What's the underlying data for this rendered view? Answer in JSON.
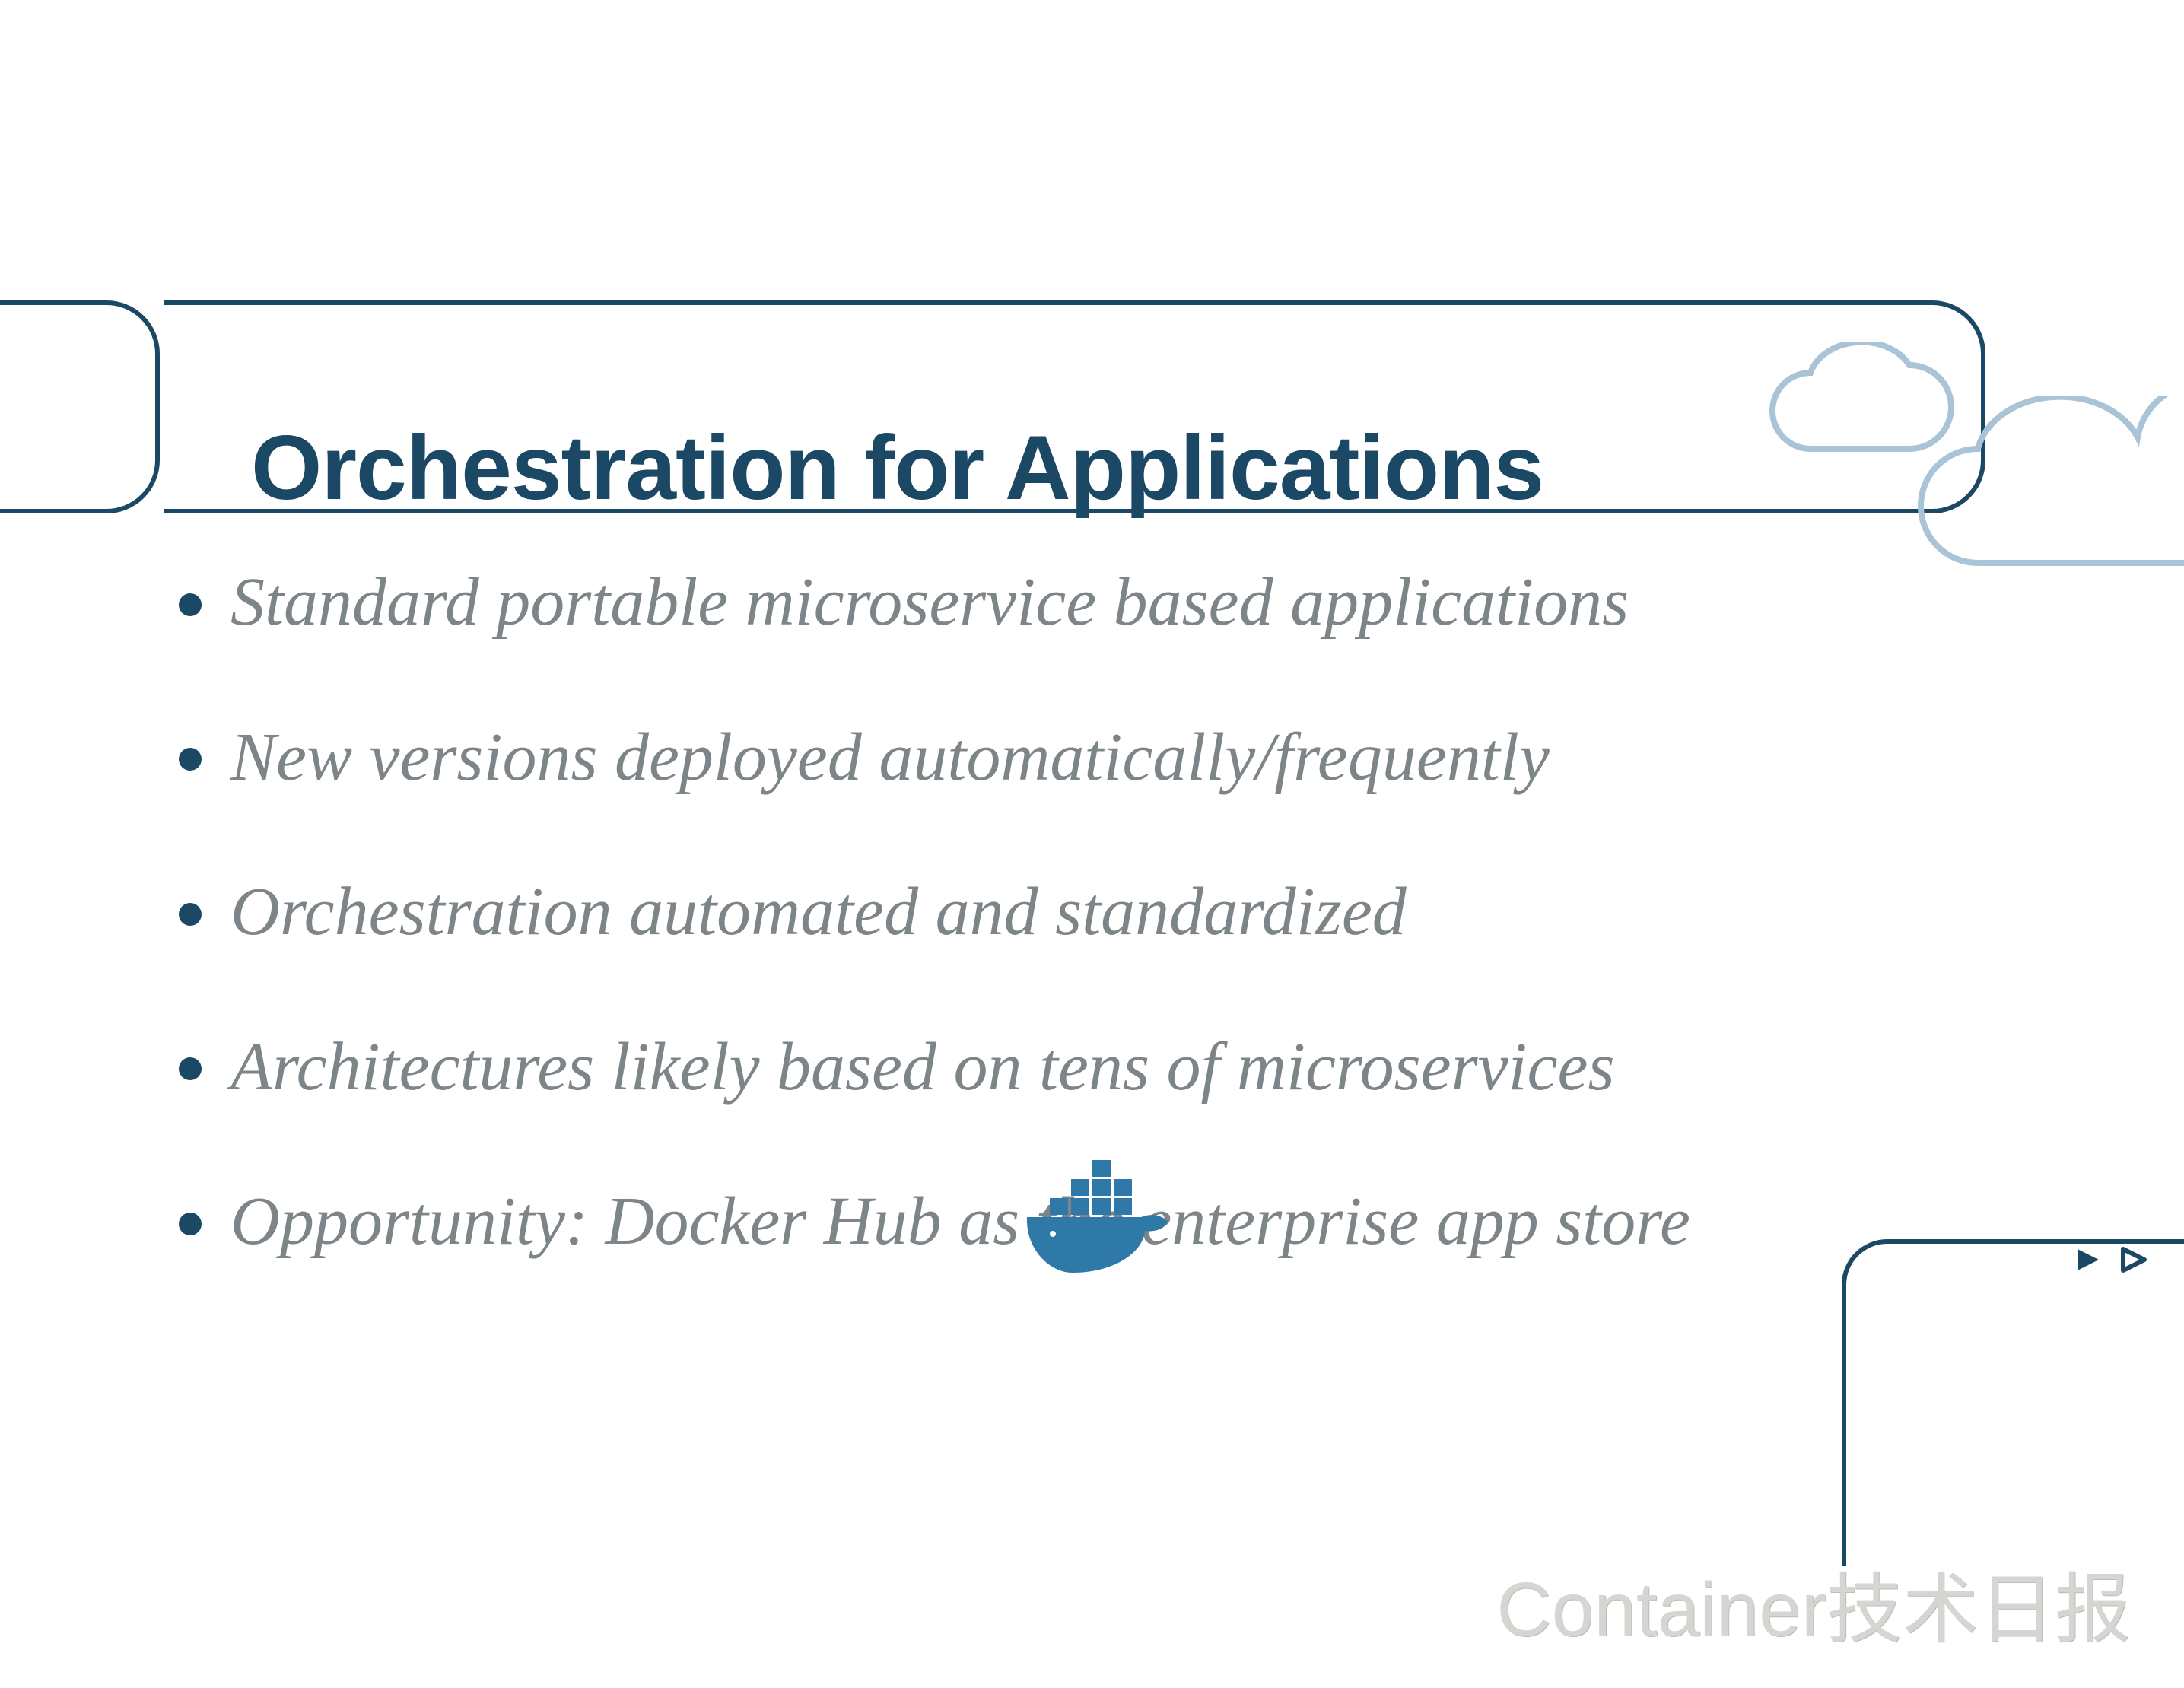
{
  "title": "Orchestration for Applications",
  "bullets": [
    {
      "pre": "Standard portable microservice based applications",
      "bold": "",
      "post": ""
    },
    {
      "pre": "New versions deployed automatically/frequently",
      "bold": "",
      "post": ""
    },
    {
      "pre": "Orchestration automated and standardized",
      "bold": "",
      "post": ""
    },
    {
      "pre": "Architectures likely based on tens of microservices",
      "bold": "",
      "post": ""
    },
    {
      "pre": "Opportunity: Docker Hub as ",
      "bold": "the",
      "post": " enterprise app store"
    }
  ],
  "watermark": "Container技术日报",
  "colors": {
    "navy": "#1b4965",
    "text_gray": "#7e8589",
    "cloud_stroke": "#a8c4d6",
    "watermark": "#d6d5d1"
  }
}
